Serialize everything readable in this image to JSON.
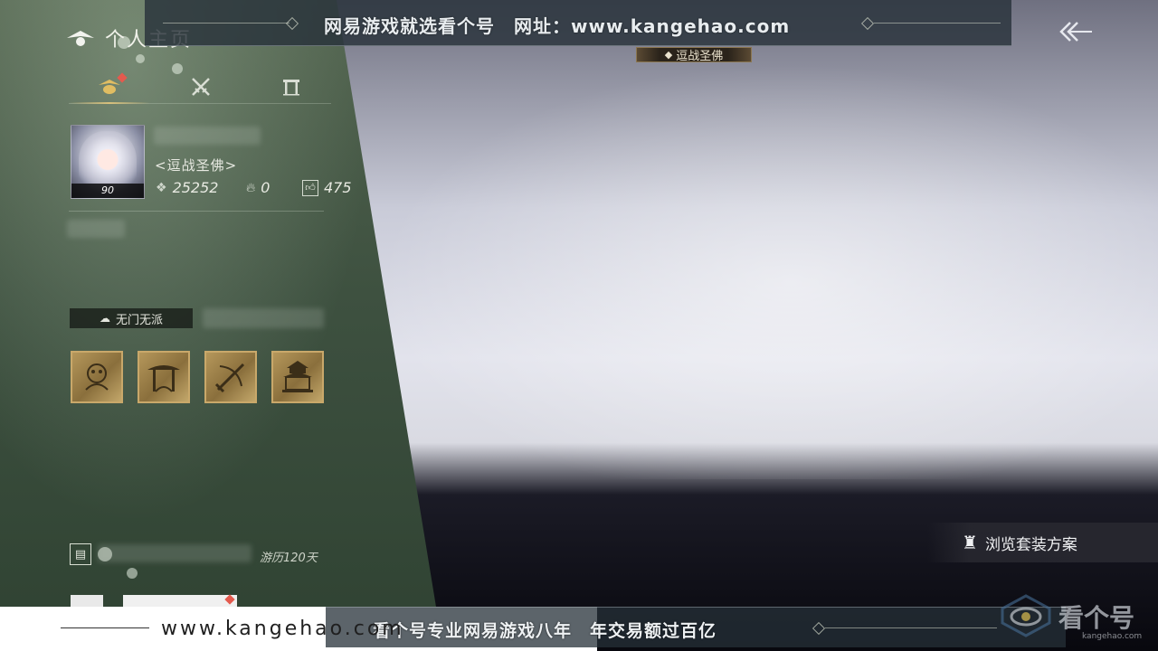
{
  "panel": {
    "title": "个人主页",
    "tabs": [
      {
        "icon": "profile-badge-icon"
      },
      {
        "icon": "crossed-swords-icon"
      },
      {
        "icon": "gate-icon"
      }
    ],
    "player": {
      "level": "90",
      "guild_title": "<逗战圣佛>",
      "power": "25252",
      "heat": "0",
      "likes": "475"
    },
    "sect": "无门无派",
    "achievements": [
      {
        "icon": "beast-crest-icon"
      },
      {
        "icon": "pavilion-gate-icon"
      },
      {
        "icon": "blade-crest-icon"
      },
      {
        "icon": "palace-crest-icon"
      }
    ],
    "travel_days": "游历120天"
  },
  "top_banner": {
    "text": "网易游戏就选看个号　网址：www.kangehao.com"
  },
  "name_plate": "逗战圣佛",
  "outfit_button": "浏览套装方案",
  "bottom_banner": {
    "url": "www.kangehao.com",
    "text": "看个号专业网易游戏八年　年交易额过百亿"
  },
  "watermark": {
    "brand": "看个号",
    "domain": "kangehao.com"
  },
  "colors": {
    "panel_green": "#3e5140",
    "gold": "#c9a86a",
    "alert_red": "#e45a4e"
  }
}
